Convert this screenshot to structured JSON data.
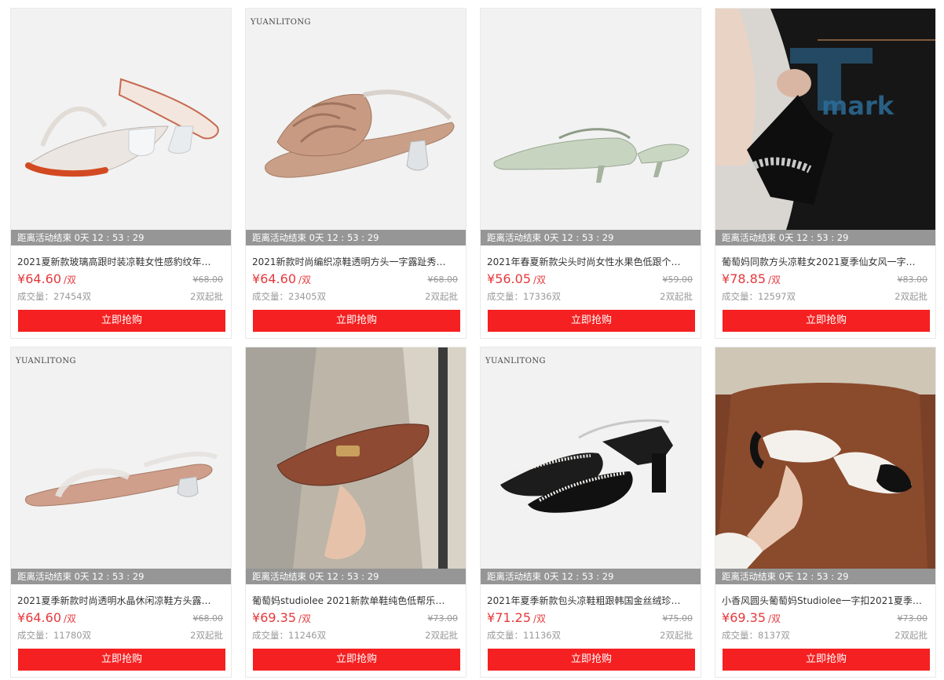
{
  "countdown_label": "距离活动结束 0天 12 : 53 : 29",
  "buy_label": "立即抢购",
  "currency": "¥",
  "unit": "/双",
  "sold_prefix": "成交量：",
  "watermark": "mark",
  "products": [
    {
      "brand": "",
      "title": "2021夏新款玻璃高跟时装凉鞋女性感豹纹年轻...",
      "price": "64.60",
      "old_price": "¥68.00",
      "sold": "27454双",
      "moq": "2双起批"
    },
    {
      "brand": "YUANLITONG",
      "title": "2021新款时尚编织凉鞋透明方头一字露趾秀气...",
      "price": "64.60",
      "old_price": "¥68.00",
      "sold": "23405双",
      "moq": "2双起批"
    },
    {
      "brand": "",
      "title": "2021年春夏新款尖头时尚女性水果色低跟个性...",
      "price": "56.05",
      "old_price": "¥59.00",
      "sold": "17336双",
      "moq": "2双起批"
    },
    {
      "brand": "",
      "title": "葡萄妈同款方头凉鞋女2021夏季仙女风一字带...",
      "price": "78.85",
      "old_price": "¥83.00",
      "sold": "12597双",
      "moq": "2双起批"
    },
    {
      "brand": "YUANLITONG",
      "title": "2021夏季新款时尚透明水晶休闲凉鞋方头露趾...",
      "price": "64.60",
      "old_price": "¥68.00",
      "sold": "11780双",
      "moq": "2双起批"
    },
    {
      "brand": "",
      "title": "葡萄妈studiolee 2021新款单鞋纯色低帮乐福鞋...",
      "price": "69.35",
      "old_price": "¥73.00",
      "sold": "11246双",
      "moq": "2双起批"
    },
    {
      "brand": "YUANLITONG",
      "title": "2021年夏季新款包头凉鞋粗跟韩国金丝绒珍珠...",
      "price": "71.25",
      "old_price": "¥75.00",
      "sold": "11136双",
      "moq": "2双起批"
    },
    {
      "brand": "",
      "title": "小香风圆头葡萄妈Studiolee一字扣2021夏季低...",
      "price": "69.35",
      "old_price": "¥73.00",
      "sold": "8137双",
      "moq": "2双起批"
    }
  ]
}
